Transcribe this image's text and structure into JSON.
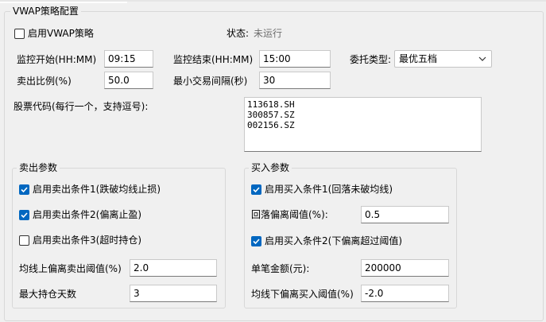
{
  "title": "VWAP策略配置",
  "enable": {
    "label": "启用VWAP策略",
    "checked": false
  },
  "status": {
    "label": "状态:",
    "value": "未运行"
  },
  "monitor_start": {
    "label": "监控开始(HH:MM)",
    "value": "09:15"
  },
  "monitor_end": {
    "label": "监控结束(HH:MM)",
    "value": "15:00"
  },
  "order_type": {
    "label": "委托类型:",
    "value": "最优五档"
  },
  "sell_ratio": {
    "label": "卖出比例(%)",
    "value": "50.0"
  },
  "min_interval": {
    "label": "最小交易间隔(秒)",
    "value": "30"
  },
  "stock_codes": {
    "label": "股票代码(每行一个，支持逗号):",
    "lines": [
      "113618.SH",
      "300857.SZ",
      "002156.SZ"
    ]
  },
  "sell_params": {
    "title": "卖出参数",
    "cond1": {
      "label": "启用卖出条件1(跌破均线止损)",
      "checked": true
    },
    "cond2": {
      "label": "启用卖出条件2(偏离止盈)",
      "checked": true
    },
    "cond3": {
      "label": "启用卖出条件3(超时持仓)",
      "checked": false
    },
    "threshold": {
      "label": "均线上偏离卖出阈值(%)",
      "value": "2.0"
    },
    "max_days": {
      "label": "最大持仓天数",
      "value": "3"
    }
  },
  "buy_params": {
    "title": "买入参数",
    "cond1": {
      "label": "启用买入条件1(回落未破均线)",
      "checked": true
    },
    "pullback": {
      "label": "回落偏离阈值(%):",
      "value": "0.5"
    },
    "cond2": {
      "label": "启用买入条件2(下偏离超过阈值)",
      "checked": true
    },
    "amount": {
      "label": "单笔金额(元):",
      "value": "200000"
    },
    "threshold": {
      "label": "均线下偏离买入阈值(%)",
      "value": "-2.0"
    }
  },
  "colors": {
    "accent": "#0067c0",
    "muted_text": "#6d6d6d",
    "background": "#f0f0f0"
  }
}
